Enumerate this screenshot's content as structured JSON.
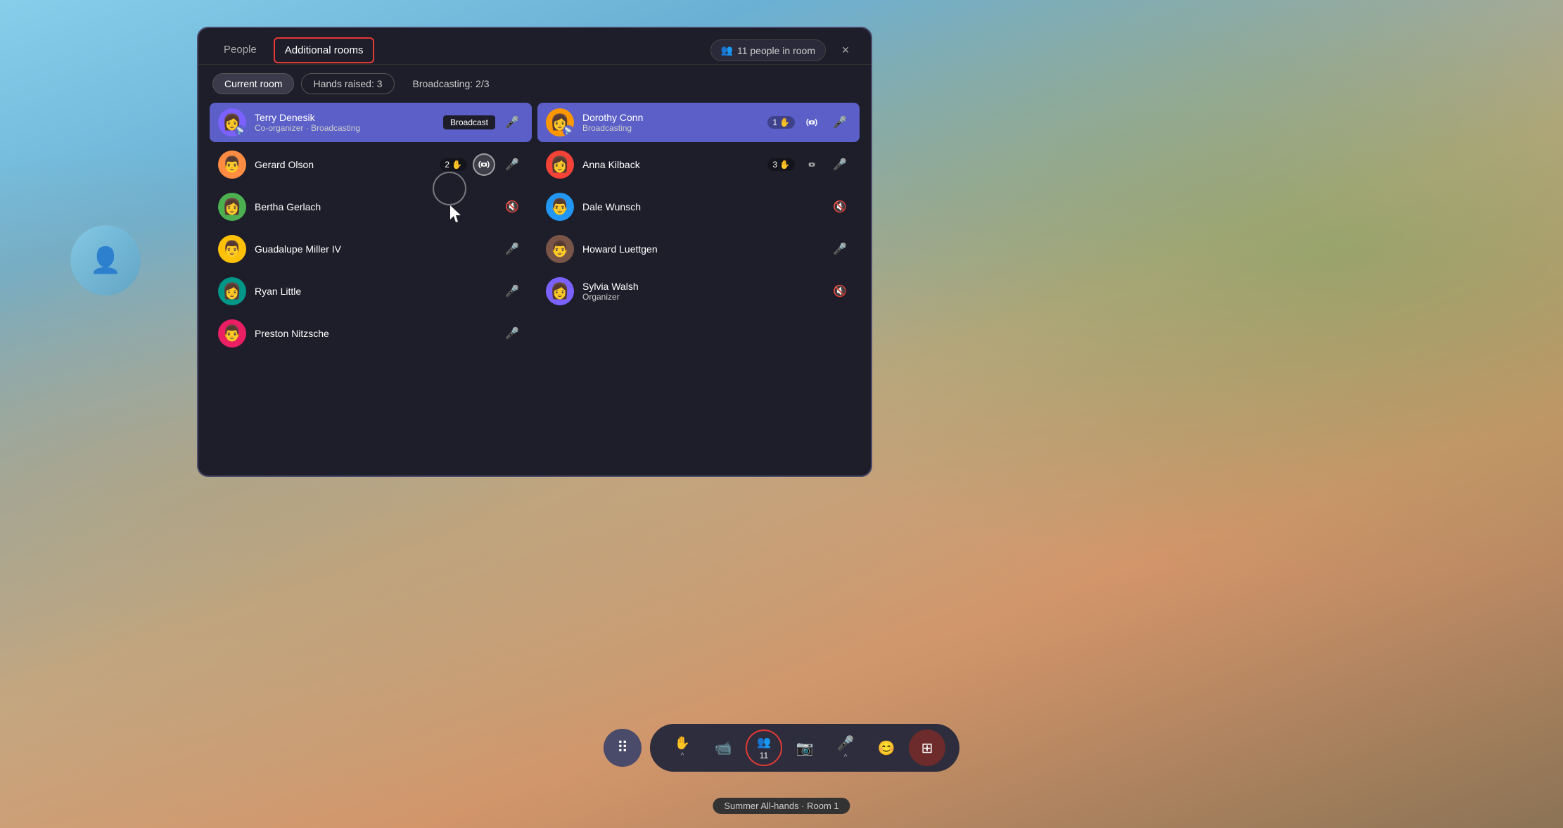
{
  "background": {
    "color": "#87ceeb"
  },
  "panel": {
    "tabs": [
      {
        "label": "People",
        "active": false
      },
      {
        "label": "Additional rooms",
        "active": true,
        "highlighted": true
      }
    ],
    "people_count": "11 people in room",
    "close_label": "×",
    "filters": [
      {
        "label": "Current room",
        "style": "selected"
      },
      {
        "label": "Hands raised: 3",
        "style": "outline"
      },
      {
        "label": "Broadcasting: 2/3",
        "style": "plain"
      }
    ],
    "left_column": [
      {
        "name": "Terry Denesik",
        "role": "Co-organizer · Broadcasting",
        "broadcasting": true,
        "badge": "Broadcast",
        "avatar_color": "av-purple",
        "avatar_emoji": "👤",
        "mic_icon": "🎤",
        "has_broadcast_signal": true
      },
      {
        "name": "Gerard Olson",
        "role": "",
        "broadcasting": false,
        "hand_count": "2",
        "avatar_color": "av-orange",
        "avatar_emoji": "👤",
        "mic_icon": "🎤",
        "active_broadcast": true
      },
      {
        "name": "Bertha Gerlach",
        "role": "",
        "broadcasting": false,
        "avatar_color": "av-green",
        "avatar_emoji": "👤",
        "mic_muted": true
      },
      {
        "name": "Guadalupe Miller IV",
        "role": "",
        "broadcasting": false,
        "avatar_color": "av-yellow",
        "avatar_emoji": "👤",
        "mic_icon": "🎤"
      },
      {
        "name": "Ryan Little",
        "role": "",
        "broadcasting": false,
        "avatar_color": "av-teal",
        "avatar_emoji": "👤",
        "mic_icon": "🎤"
      },
      {
        "name": "Preston Nitzsche",
        "role": "",
        "broadcasting": false,
        "avatar_color": "av-pink",
        "avatar_emoji": "👤",
        "mic_icon": "🎤"
      }
    ],
    "right_column": [
      {
        "name": "Dorothy Conn",
        "role": "Broadcasting",
        "broadcasting": true,
        "hand_count": "1",
        "avatar_color": "av-amber",
        "avatar_emoji": "👤",
        "has_broadcast_signal": true,
        "mic_icon": "🎤"
      },
      {
        "name": "Anna Kilback",
        "role": "",
        "broadcasting": false,
        "hand_count": "3",
        "avatar_color": "av-red",
        "avatar_emoji": "👤",
        "has_broadcast_signal": true,
        "mic_icon": "🎤"
      },
      {
        "name": "Dale Wunsch",
        "role": "",
        "broadcasting": false,
        "avatar_color": "av-blue",
        "avatar_emoji": "👤",
        "mic_muted": true
      },
      {
        "name": "Howard Luettgen",
        "role": "",
        "broadcasting": false,
        "avatar_color": "av-brown",
        "avatar_emoji": "👤",
        "mic_icon": "🎤"
      },
      {
        "name": "Sylvia Walsh",
        "role": "Organizer",
        "broadcasting": false,
        "avatar_color": "av-purple",
        "avatar_emoji": "👤",
        "mic_muted": true
      }
    ]
  },
  "toolbar": {
    "grid_icon": "⠿",
    "buttons": [
      {
        "label": "↑",
        "sub": "",
        "name": "raise-hand-btn"
      },
      {
        "label": "🎬",
        "sub": "",
        "name": "content-btn"
      },
      {
        "label": "👥 11",
        "sub": "",
        "name": "people-btn",
        "highlighted": true
      },
      {
        "label": "📷",
        "sub": "",
        "name": "camera-btn"
      },
      {
        "label": "🎤",
        "sub": "",
        "name": "mic-btn"
      },
      {
        "label": "😊",
        "sub": "",
        "name": "emoji-btn"
      },
      {
        "label": "⊞",
        "sub": "",
        "name": "layout-btn"
      }
    ]
  },
  "room_label": "Summer All-hands · Room 1"
}
